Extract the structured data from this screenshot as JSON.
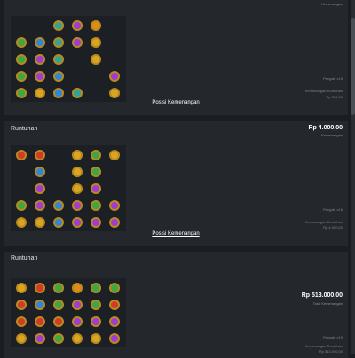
{
  "panels": [
    {
      "title": "",
      "amount": "",
      "amount_sub": "Kemenangan",
      "multiplier": "Pengali: x15",
      "win_label": "Kemenangan Runtuhan",
      "win_value": "Rp 300,00",
      "link": "Posisi Kemenangan"
    },
    {
      "title": "Runtuhan",
      "amount": "Rp 4.000,00",
      "amount_sub": "Kemenangan",
      "multiplier": "Pengali: x16",
      "win_label": "Kemenangan Runtuhan",
      "win_value": "Rp 4.000,00",
      "link": "Posisi Kemenangan"
    },
    {
      "title": "Runtuhan",
      "amount": "Rp 513.000,00",
      "amount_sub": "Total Kemenangan",
      "multiplier": "Pengali: x19",
      "win_label": "Kemenangan Runtuhan",
      "win_value": "Rp 513.000,00",
      "link": ""
    }
  ],
  "colors": {
    "red": "#d23a2a",
    "blue": "#2f86d8",
    "green": "#39a845",
    "purple": "#a23bd1",
    "orange": "#e28a16",
    "gold": "#d9a522",
    "teal": "#2fa59a"
  }
}
